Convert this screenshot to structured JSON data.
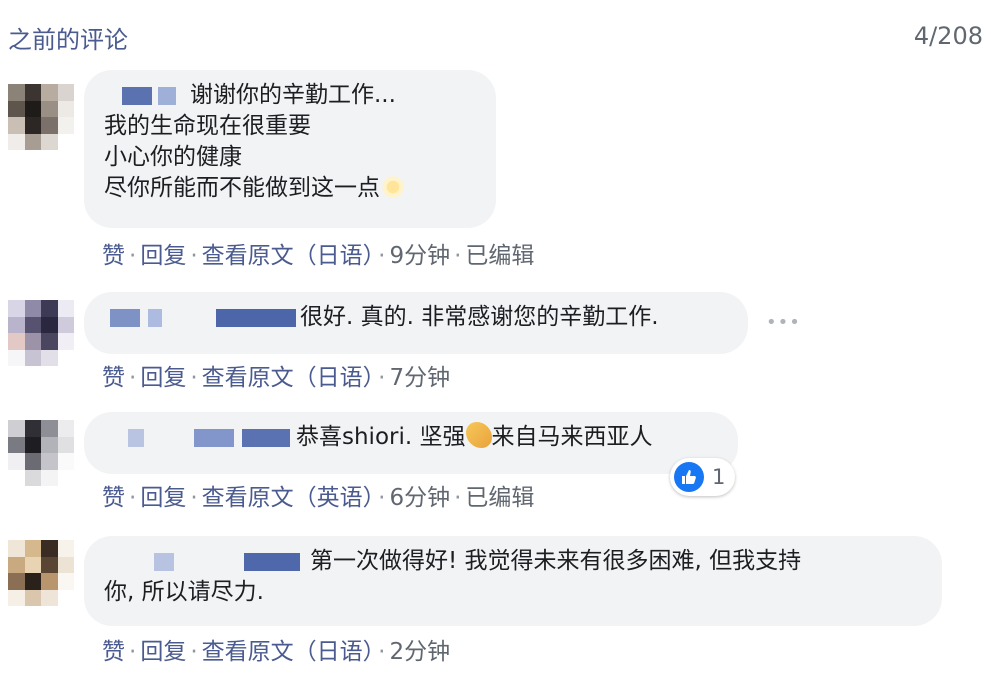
{
  "header": {
    "title": "之前的评论",
    "count": "4/208"
  },
  "comments": [
    {
      "lines": [
        "谢谢你的辛勤工作...",
        "我的生命现在很重要",
        "小心你的健康",
        "尽你所能而不能做到这一点"
      ],
      "emoji": "sun",
      "actions": {
        "like": "赞",
        "reply": "回复",
        "translate": "查看原文（日语）",
        "time": "9分钟",
        "edited": "已编辑"
      }
    },
    {
      "lines": [
        "很好. 真的. 非常感谢您的辛勤工作."
      ],
      "actions": {
        "like": "赞",
        "reply": "回复",
        "translate": "查看原文（日语）",
        "time": "7分钟"
      }
    },
    {
      "line_before_emoji": "恭喜shiori. 坚强",
      "line_after_emoji": "来自马来西亚人",
      "emoji": "flexed-biceps",
      "reaction": {
        "icon": "like-thumb-icon",
        "count": "1"
      },
      "actions": {
        "like": "赞",
        "reply": "回复",
        "translate": "查看原文（英语）",
        "time": "6分钟",
        "edited": "已编辑"
      }
    },
    {
      "lines": [
        "第一次做得好! 我觉得未来有很多困难, 但我支持",
        "你, 所以请尽力."
      ],
      "actions": {
        "like": "赞",
        "reply": "回复",
        "translate": "查看原文（日语）",
        "time": "2分钟"
      }
    }
  ],
  "colors": {
    "link": "#4b5b8f",
    "bubble": "#f2f3f5",
    "meta": "#606770",
    "like_blue": "#1877f2"
  }
}
